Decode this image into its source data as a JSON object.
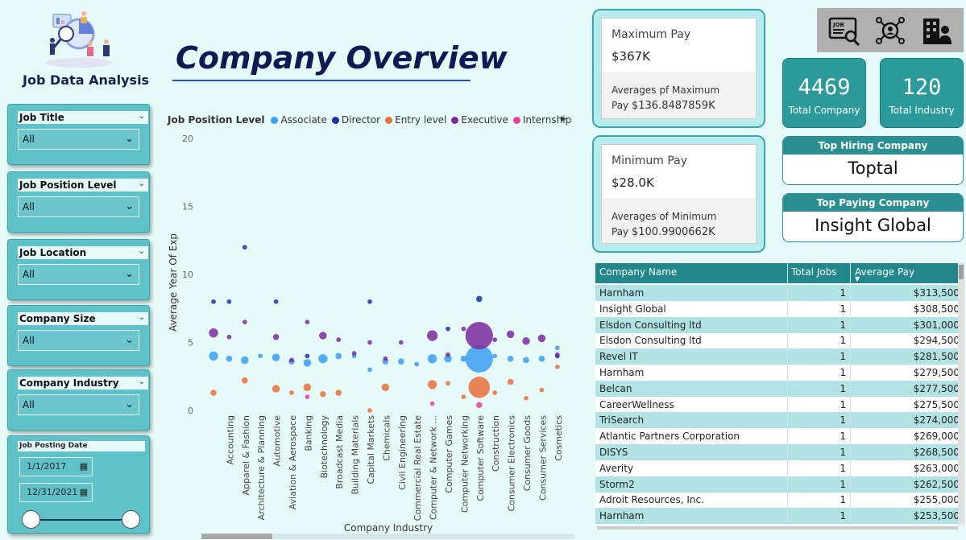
{
  "app": {
    "title": "Job Data Analysis",
    "page_title": "Company Overview"
  },
  "filters": [
    {
      "label": "Job Title",
      "value": "All"
    },
    {
      "label": "Job Position Level",
      "value": "All"
    },
    {
      "label": "Job Location",
      "value": "All"
    },
    {
      "label": "Company Size",
      "value": "All"
    },
    {
      "label": "Company Industry",
      "value": "All"
    }
  ],
  "date_filter": {
    "label": "Job Posting Date",
    "start": "1/1/2017",
    "end": "12/31/2021"
  },
  "pay": {
    "max": {
      "label": "Maximum Pay",
      "value": "$367K",
      "avg_label_1": "Averages pf Maximum",
      "avg_label_2": "Pay",
      "avg_value": "$136.8487859K"
    },
    "min": {
      "label": "Minimum Pay",
      "value": "$28.0K",
      "avg_label_1": "Averages of Minimum",
      "avg_label_2": "Pay",
      "avg_value": "$100.9900662K"
    }
  },
  "kpis": {
    "total_company": {
      "value": "4469",
      "label": "Total Company"
    },
    "total_industry": {
      "value": "120",
      "label": "Total Industry"
    }
  },
  "top_hiring": {
    "label": "Top Hiring Company",
    "value": "Toptal"
  },
  "top_paying": {
    "label": "Top Paying Company",
    "value": "Insight Global"
  },
  "icons": [
    "job-search-icon",
    "settings-network-icon",
    "company-building-icon"
  ],
  "table": {
    "columns": [
      "Company Name",
      "Total Jobs",
      "Average Pay"
    ],
    "rows": [
      [
        "Harnham",
        "1",
        "$313,500"
      ],
      [
        "Insight Global",
        "1",
        "$308,500"
      ],
      [
        "Elsdon Consulting ltd",
        "1",
        "$301,000"
      ],
      [
        "Elsdon Consulting ltd",
        "1",
        "$294,500"
      ],
      [
        "Revel IT",
        "1",
        "$281,500"
      ],
      [
        "Harnham",
        "1",
        "$279,500"
      ],
      [
        "Belcan",
        "1",
        "$277,500"
      ],
      [
        "CareerWellness",
        "1",
        "$275,500"
      ],
      [
        "TriSearch",
        "1",
        "$274,000"
      ],
      [
        "Atlantic Partners Corporation",
        "1",
        "$269,000"
      ],
      [
        "DISYS",
        "1",
        "$268,500"
      ],
      [
        "Averity",
        "1",
        "$263,000"
      ],
      [
        "Storm2",
        "1",
        "$262,500"
      ],
      [
        "Adroit Resources, Inc.",
        "1",
        "$255,000"
      ],
      [
        "Harnham",
        "1",
        "$253,500"
      ]
    ]
  },
  "chart_data": {
    "type": "scatter",
    "legend_title": "Job Position Level",
    "xlabel": "Company Industry",
    "ylabel": "Average Year Of Exp",
    "ylim": [
      0,
      20
    ],
    "yticks": [
      0,
      5,
      10,
      15,
      20
    ],
    "categories": [
      "Accounting",
      "Apparel & Fashion",
      "Architecture & Planning",
      "Automotive",
      "Aviation & Aerospace",
      "Banking",
      "Biotechnology",
      "Broadcast Media",
      "Building Materials",
      "Capital Markets",
      "Chemicals",
      "Civil Engineering",
      "Commercial Real Estate",
      "Computer & Network ...",
      "Computer Games",
      "Computer Networking",
      "Computer Software",
      "Construction",
      "Consumer Electronics",
      "Consumer Goods",
      "Consumer Services",
      "Cosmetics"
    ],
    "series": [
      {
        "name": "Associate",
        "color": "#3a9ff2",
        "points": [
          [
            -1,
            4.0,
            3
          ],
          [
            0,
            3.8,
            2
          ],
          [
            1,
            3.7,
            2.5
          ],
          [
            2,
            4.0,
            1.5
          ],
          [
            3,
            3.9,
            2.5
          ],
          [
            4,
            3.6,
            2
          ],
          [
            5,
            3.5,
            2.5
          ],
          [
            6,
            3.8,
            3
          ],
          [
            7,
            4.0,
            2
          ],
          [
            8,
            4.0,
            1.5
          ],
          [
            9,
            3.0,
            1.5
          ],
          [
            10,
            3.6,
            2
          ],
          [
            11,
            3.6,
            2
          ],
          [
            12,
            3.4,
            1.5
          ],
          [
            13,
            3.8,
            3
          ],
          [
            14,
            3.8,
            2.5
          ],
          [
            15,
            3.8,
            2
          ],
          [
            16,
            3.8,
            9
          ],
          [
            17,
            4.0,
            1.5
          ],
          [
            18,
            3.8,
            2
          ],
          [
            19,
            3.7,
            2
          ],
          [
            20,
            3.8,
            2
          ],
          [
            21,
            4.6,
            1.5
          ]
        ]
      },
      {
        "name": "Director",
        "color": "#1f2fa8",
        "points": [
          [
            -1,
            8.0,
            1.5
          ],
          [
            0,
            8.0,
            1.5
          ],
          [
            1,
            12.0,
            1.5
          ],
          [
            3,
            8.0,
            1.5
          ],
          [
            5,
            4.0,
            1.5
          ],
          [
            9,
            8.0,
            1.5
          ],
          [
            14,
            6.0,
            1.5
          ],
          [
            16,
            8.2,
            2
          ],
          [
            21,
            4.0,
            1.5
          ]
        ]
      },
      {
        "name": "Entry level",
        "color": "#e8703a",
        "points": [
          [
            -1,
            1.3,
            2
          ],
          [
            1,
            2.2,
            2
          ],
          [
            3,
            1.6,
            2.5
          ],
          [
            4,
            1.3,
            1.5
          ],
          [
            5,
            1.7,
            2.5
          ],
          [
            6,
            1.2,
            2
          ],
          [
            7,
            1.3,
            2
          ],
          [
            9,
            0.0,
            1.5
          ],
          [
            10,
            1.7,
            2.5
          ],
          [
            13,
            1.9,
            3
          ],
          [
            14,
            2.0,
            1.5
          ],
          [
            15,
            1.0,
            1.5
          ],
          [
            16,
            1.7,
            7
          ],
          [
            17,
            1.3,
            1.5
          ],
          [
            18,
            2.1,
            2
          ],
          [
            19,
            0.9,
            1.5
          ],
          [
            20,
            1.5,
            1.5
          ],
          [
            21,
            3.2,
            1.5
          ]
        ]
      },
      {
        "name": "Executive",
        "color": "#7a2a9e",
        "points": [
          [
            -1,
            5.7,
            3
          ],
          [
            0,
            5.4,
            1.5
          ],
          [
            1,
            6.5,
            1.5
          ],
          [
            3,
            5.4,
            2
          ],
          [
            4,
            3.7,
            1.5
          ],
          [
            5,
            6.5,
            1.5
          ],
          [
            6,
            5.5,
            2.5
          ],
          [
            7,
            5.2,
            1.5
          ],
          [
            8,
            4.2,
            1.5
          ],
          [
            9,
            5.0,
            1.5
          ],
          [
            10,
            3.8,
            1.5
          ],
          [
            11,
            5.0,
            1.5
          ],
          [
            13,
            5.5,
            3.5
          ],
          [
            14,
            4.1,
            1.5
          ],
          [
            15,
            6.0,
            1.5
          ],
          [
            16,
            5.5,
            9
          ],
          [
            17,
            5.2,
            1.5
          ],
          [
            18,
            5.6,
            2.5
          ],
          [
            19,
            5.1,
            2.5
          ],
          [
            20,
            5.3,
            2.5
          ],
          [
            21,
            4.1,
            1.5
          ]
        ]
      },
      {
        "name": "Internship",
        "color": "#e83fa0",
        "points": [
          [
            5,
            1.0,
            1.5
          ],
          [
            13,
            0.5,
            1.5
          ],
          [
            16,
            0.4,
            2
          ]
        ]
      }
    ]
  }
}
